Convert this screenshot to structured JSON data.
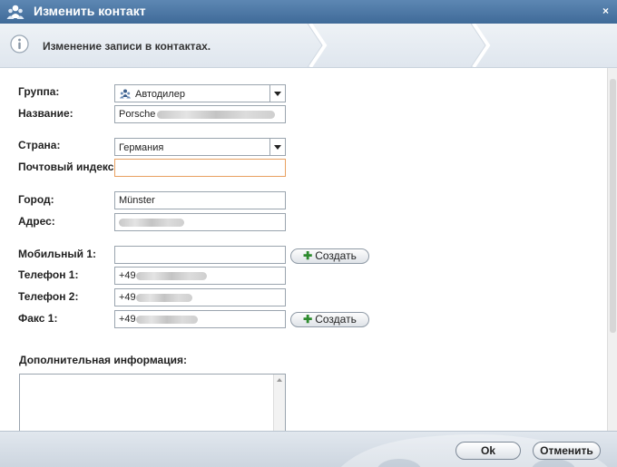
{
  "window": {
    "title": "Изменить контакт",
    "close_glyph": "×",
    "icon": "contacts-icon"
  },
  "info": {
    "text": "Изменение записи в контактах.",
    "icon": "info-icon"
  },
  "form": {
    "group": {
      "label": "Группа:",
      "value": "Автодилер",
      "icon": "group-icon"
    },
    "name": {
      "label": "Название:",
      "value": "Porsche"
    },
    "country": {
      "label": "Страна:",
      "value": "Германия"
    },
    "postal": {
      "label": "Почтовый индекс:",
      "value": ""
    },
    "city": {
      "label": "Город:",
      "value": "Münster"
    },
    "address": {
      "label": "Адрес:",
      "value": ""
    },
    "mobile1": {
      "label": "Мобильный 1:",
      "value": ""
    },
    "phone1": {
      "label": "Телефон 1:",
      "value": "+49"
    },
    "phone2": {
      "label": "Телефон 2:",
      "value": "+49"
    },
    "fax1": {
      "label": "Факс 1:",
      "value": "+49"
    },
    "create_label": "Создать",
    "extra": {
      "label": "Дополнительная информация:",
      "value": ""
    }
  },
  "footer": {
    "ok_label": "Ok",
    "cancel_label": "Отменить"
  },
  "colors": {
    "titlebar": "#4a76a5",
    "focus_border": "#e8a060",
    "plus": "#2e8b2e"
  }
}
